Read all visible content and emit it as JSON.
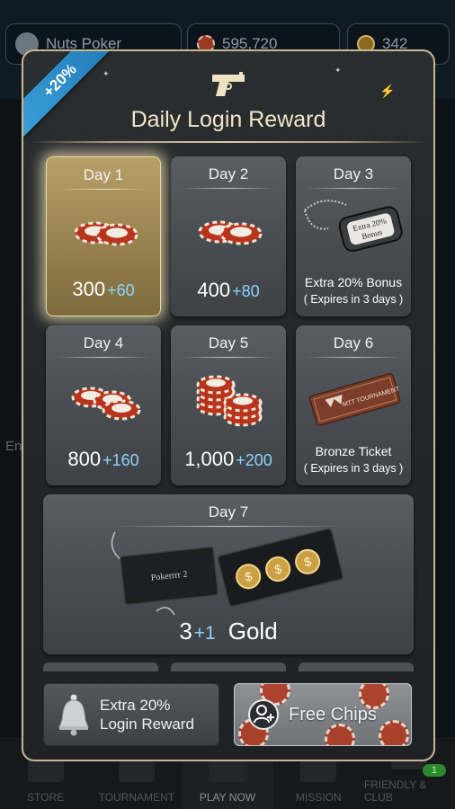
{
  "background": {
    "username": "Nuts Poker",
    "chips": "595,720",
    "gold": "342",
    "side_text": "En"
  },
  "nav": [
    {
      "label": "STORE"
    },
    {
      "label": "TOURNAMENT"
    },
    {
      "label": "PLAY NOW"
    },
    {
      "label": "MISSION"
    },
    {
      "label": "FRIENDLY & CLUB",
      "badge": "1"
    }
  ],
  "modal": {
    "ribbon": "+20%",
    "title": "Daily Login Reward",
    "header_icon": "gun-icon",
    "days": [
      {
        "day": "Day 1",
        "value": "300",
        "bonus": "+60",
        "reward": "chips",
        "active": true
      },
      {
        "day": "Day 2",
        "value": "400",
        "bonus": "+80",
        "reward": "chips"
      },
      {
        "day": "Day 3",
        "line1": "Extra 20% Bonus",
        "line2": "( Expires in 3 days )",
        "reward": "dog-tag",
        "tag_text": "Extra 20%",
        "tag_text2": "Bonus"
      },
      {
        "day": "Day 4",
        "value": "800",
        "bonus": "+160",
        "reward": "chips"
      },
      {
        "day": "Day 5",
        "value": "1,000",
        "bonus": "+200",
        "reward": "chips"
      },
      {
        "day": "Day 6",
        "line1": "Bronze Ticket",
        "line2": "( Expires in 3 days )",
        "reward": "ticket",
        "ticket_text": "MTT TOURNAMENT"
      },
      {
        "day": "Day 7",
        "value": "3",
        "bonus": "+1",
        "unit": "Gold",
        "reward": "gold-box",
        "box_text": "Pokerrrr 2"
      }
    ],
    "buttons": {
      "extra_line1": "Extra 20%",
      "extra_line2": "Login Reward",
      "free_chips": "Free Chips"
    }
  },
  "colors": {
    "accent_gold": "#c8b890",
    "bonus_blue": "#8fd3ff",
    "ribbon_blue": "#2a8fcf"
  }
}
